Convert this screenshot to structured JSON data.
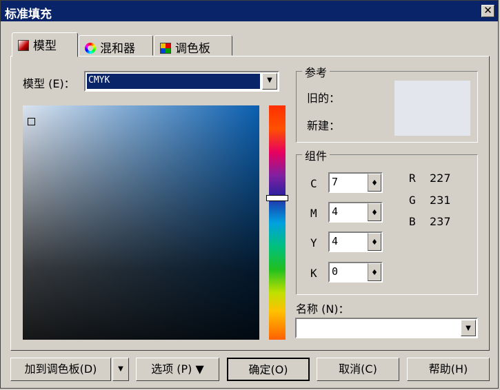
{
  "window": {
    "title": "标准填充",
    "close_glyph": "✕"
  },
  "tabs": [
    {
      "label": "模型",
      "active": true
    },
    {
      "label": "混和器",
      "active": false
    },
    {
      "label": "调色板",
      "active": false
    }
  ],
  "model": {
    "label": "模型 (E)：",
    "value": "CMYK",
    "arrow": "▼"
  },
  "reference": {
    "legend": "参考",
    "old_label": "旧的：",
    "new_label": "新建："
  },
  "components": {
    "legend": "组件",
    "fields": [
      {
        "label": "C",
        "value": "7"
      },
      {
        "label": "M",
        "value": "4"
      },
      {
        "label": "Y",
        "value": "4"
      },
      {
        "label": "K",
        "value": "0"
      }
    ],
    "spin_glyph": "♦",
    "rgb": [
      {
        "label": "R",
        "value": "227"
      },
      {
        "label": "G",
        "value": "231"
      },
      {
        "label": "B",
        "value": "237"
      }
    ]
  },
  "name": {
    "label": "名称 (N)：",
    "value": "",
    "arrow": "▼"
  },
  "buttons": {
    "add_palette": "加到调色板(D)",
    "add_palette_arrow": "▼",
    "options": "选项 (P) ▼",
    "ok": "确定(O)",
    "cancel": "取消(C)",
    "help": "帮助(H)"
  },
  "colors": {
    "titlebar": "#0a246a",
    "face": "#d4d0c8",
    "swatch": "#e3e7ed"
  }
}
